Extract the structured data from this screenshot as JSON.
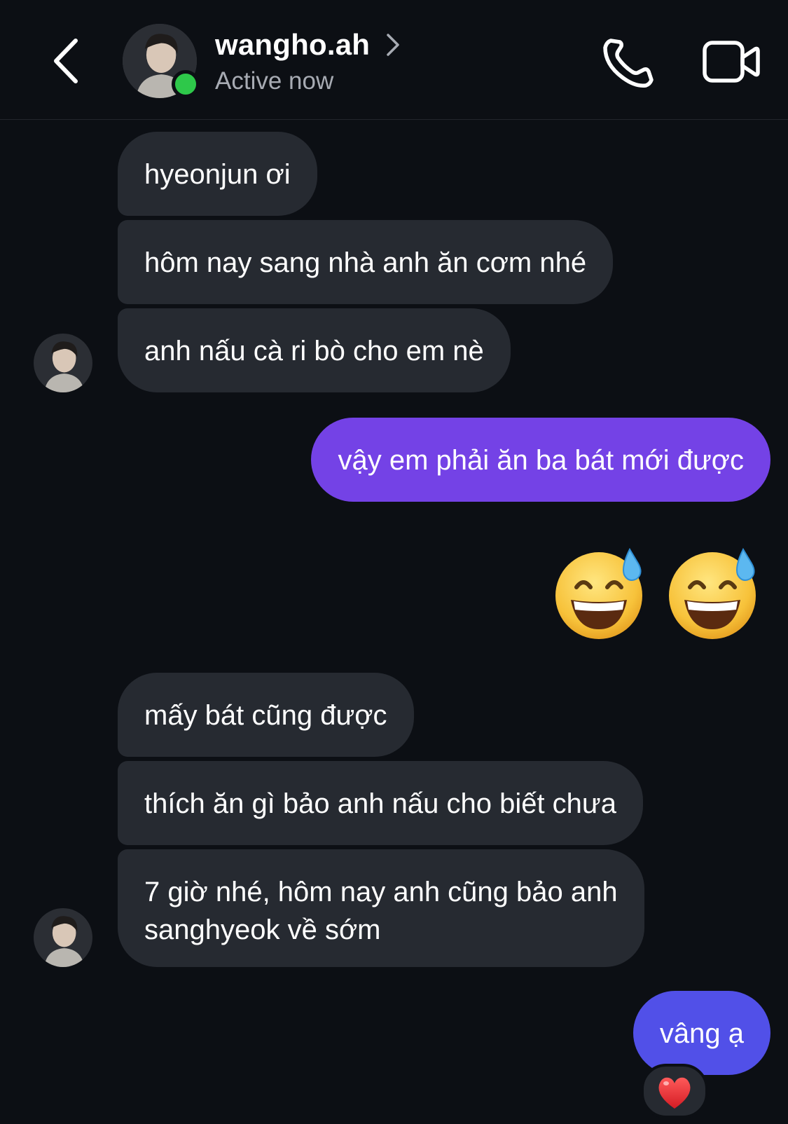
{
  "header": {
    "contact_name": "wangho.ah",
    "status": "Active now",
    "icons": {
      "back": "chevron-left-icon",
      "chevron": "chevron-right-icon",
      "call": "phone-icon",
      "video": "video-camera-icon"
    }
  },
  "colors": {
    "background": "#0c0f14",
    "incoming_bubble": "#262a31",
    "outgoing_bubble": "#7442e6",
    "online": "#2ec84a"
  },
  "messages": [
    {
      "from": "them",
      "text": "hyeonjun ơi"
    },
    {
      "from": "them",
      "text": "hôm nay sang nhà anh ăn cơm nhé"
    },
    {
      "from": "them",
      "text": "anh nấu cà ri bò cho em nè"
    },
    {
      "from": "me",
      "text": "vậy em phải ăn ba bát mới được"
    },
    {
      "from": "me",
      "type": "emoji",
      "emoji": "grinning-face-with-sweat-icon",
      "count": 2
    },
    {
      "from": "them",
      "text": "mấy bát cũng được"
    },
    {
      "from": "them",
      "text": "thích ăn gì bảo anh nấu cho biết chưa"
    },
    {
      "from": "them",
      "lines": [
        "7 giờ nhé, hôm nay anh cũng bảo anh",
        "sanghyeok về sớm"
      ]
    },
    {
      "from": "me",
      "text": "vâng ạ",
      "reaction": "heart-icon"
    }
  ]
}
